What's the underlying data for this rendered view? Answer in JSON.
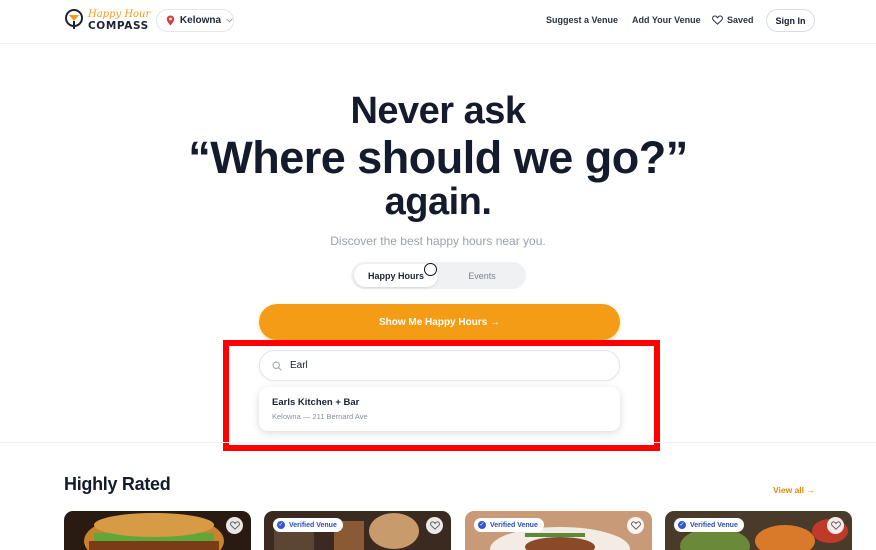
{
  "brand": {
    "logo_top": "Happy Hour",
    "logo_bottom": "COMPASS",
    "accent_color": "#f49c16"
  },
  "location": {
    "city": "Kelowna",
    "icon": "map-pin-icon"
  },
  "nav": {
    "suggest": "Suggest a Venue",
    "add": "Add Your Venue",
    "saved": "Saved",
    "signin": "Sign In"
  },
  "hero": {
    "line1": "Never ask",
    "line2": "“Where should we go?”",
    "line3": "again.",
    "subtitle": "Discover the best happy hours near you."
  },
  "toggle": {
    "options": [
      "Happy Hours",
      "Events"
    ],
    "selected": "Happy Hours"
  },
  "cta": {
    "label": "Show Me Happy Hours →"
  },
  "search": {
    "value": "Earl",
    "icon": "search-icon"
  },
  "suggestions": [
    {
      "name": "Earls Kitchen + Bar",
      "address": "Kelowna — 211 Bernard Ave"
    }
  ],
  "highly_rated": {
    "title": "Highly Rated",
    "view_all": "View all →",
    "cards": [
      {
        "badge": ""
      },
      {
        "badge": "Verified Venue"
      },
      {
        "badge": "Verified Venue"
      },
      {
        "badge": "Verified Venue"
      }
    ]
  }
}
